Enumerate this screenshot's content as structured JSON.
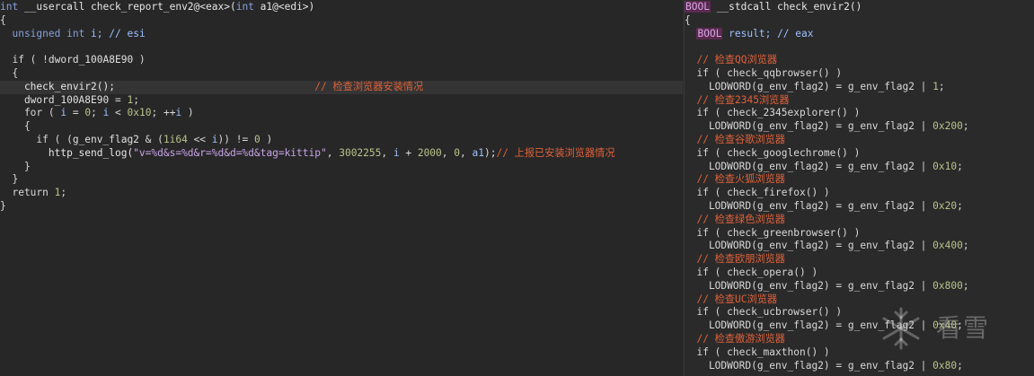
{
  "left": {
    "lines": [
      {
        "highlight": false,
        "tokens": [
          {
            "t": "int",
            "c": "kw"
          },
          {
            "t": " __usercall check_report_env2@<eax>(",
            "c": "fn"
          },
          {
            "t": "int",
            "c": "kw"
          },
          {
            "t": " a1@<edi>)",
            "c": "fn"
          }
        ]
      },
      {
        "highlight": false,
        "tokens": [
          {
            "t": "{",
            "c": "plain"
          }
        ]
      },
      {
        "highlight": false,
        "tokens": [
          {
            "t": "  unsigned ",
            "c": "kw"
          },
          {
            "t": "int",
            "c": "kw"
          },
          {
            "t": " i; ",
            "c": "var"
          },
          {
            "t": "// esi",
            "c": "var"
          }
        ]
      },
      {
        "highlight": false,
        "tokens": [
          {
            "t": "",
            "c": "plain"
          }
        ]
      },
      {
        "highlight": false,
        "tokens": [
          {
            "t": "  if ( !",
            "c": "plain"
          },
          {
            "t": "dword_100A8E90",
            "c": "gv"
          },
          {
            "t": " )",
            "c": "plain"
          }
        ]
      },
      {
        "highlight": false,
        "tokens": [
          {
            "t": "  {",
            "c": "plain"
          }
        ]
      },
      {
        "highlight": true,
        "tokens": [
          {
            "t": "    check_envir2();",
            "c": "fn"
          },
          {
            "t": "                                 ",
            "c": "plain"
          },
          {
            "t": "// 检查浏览器安装情况",
            "c": "cmt"
          }
        ]
      },
      {
        "highlight": false,
        "tokens": [
          {
            "t": "    dword_100A8E90",
            "c": "gv"
          },
          {
            "t": " = ",
            "c": "plain"
          },
          {
            "t": "1",
            "c": "num"
          },
          {
            "t": ";",
            "c": "plain"
          }
        ]
      },
      {
        "highlight": false,
        "tokens": [
          {
            "t": "    for ( ",
            "c": "plain"
          },
          {
            "t": "i",
            "c": "var"
          },
          {
            "t": " = ",
            "c": "plain"
          },
          {
            "t": "0",
            "c": "num"
          },
          {
            "t": "; ",
            "c": "plain"
          },
          {
            "t": "i",
            "c": "var"
          },
          {
            "t": " < ",
            "c": "plain"
          },
          {
            "t": "0x10",
            "c": "num"
          },
          {
            "t": "; ++",
            "c": "plain"
          },
          {
            "t": "i",
            "c": "var"
          },
          {
            "t": " )",
            "c": "plain"
          }
        ]
      },
      {
        "highlight": false,
        "tokens": [
          {
            "t": "    {",
            "c": "plain"
          }
        ]
      },
      {
        "highlight": false,
        "tokens": [
          {
            "t": "      if ( (",
            "c": "plain"
          },
          {
            "t": "g_env_flag2",
            "c": "gv"
          },
          {
            "t": " & (",
            "c": "plain"
          },
          {
            "t": "1i64",
            "c": "num"
          },
          {
            "t": " << ",
            "c": "plain"
          },
          {
            "t": "i",
            "c": "var"
          },
          {
            "t": ")) != ",
            "c": "plain"
          },
          {
            "t": "0",
            "c": "num"
          },
          {
            "t": " )",
            "c": "plain"
          }
        ]
      },
      {
        "highlight": false,
        "tokens": [
          {
            "t": "        http_send_log(",
            "c": "fn"
          },
          {
            "t": "\"v=%d&s=%d&r=%d&d=%d&tag=kittip\"",
            "c": "str"
          },
          {
            "t": ", ",
            "c": "plain"
          },
          {
            "t": "3002255",
            "c": "num"
          },
          {
            "t": ", ",
            "c": "plain"
          },
          {
            "t": "i",
            "c": "var"
          },
          {
            "t": " + ",
            "c": "plain"
          },
          {
            "t": "2000",
            "c": "num"
          },
          {
            "t": ", ",
            "c": "plain"
          },
          {
            "t": "0",
            "c": "num"
          },
          {
            "t": ", ",
            "c": "plain"
          },
          {
            "t": "a1",
            "c": "var"
          },
          {
            "t": ");",
            "c": "plain"
          },
          {
            "t": "// 上报已安装浏览器情况",
            "c": "cmt"
          }
        ]
      },
      {
        "highlight": false,
        "tokens": [
          {
            "t": "    }",
            "c": "plain"
          }
        ]
      },
      {
        "highlight": false,
        "tokens": [
          {
            "t": "  }",
            "c": "plain"
          }
        ]
      },
      {
        "highlight": false,
        "tokens": [
          {
            "t": "  return ",
            "c": "plain"
          },
          {
            "t": "1",
            "c": "num"
          },
          {
            "t": ";",
            "c": "plain"
          }
        ]
      },
      {
        "highlight": false,
        "tokens": [
          {
            "t": "}",
            "c": "plain"
          }
        ]
      }
    ]
  },
  "right": {
    "lines": [
      {
        "tokens": [
          {
            "t": "BOOL",
            "c": "boolt"
          },
          {
            "t": " __stdcall check_envir2()",
            "c": "fn"
          }
        ]
      },
      {
        "tokens": [
          {
            "t": "{",
            "c": "plain"
          }
        ]
      },
      {
        "tokens": [
          {
            "t": "  ",
            "c": "plain"
          },
          {
            "t": "BOOL",
            "c": "boolt"
          },
          {
            "t": " result; ",
            "c": "var"
          },
          {
            "t": "// eax",
            "c": "var"
          }
        ]
      },
      {
        "tokens": [
          {
            "t": "",
            "c": "plain"
          }
        ]
      },
      {
        "tokens": [
          {
            "t": "  // 检查QQ浏览器",
            "c": "cmt"
          }
        ]
      },
      {
        "tokens": [
          {
            "t": "  if ( check_qqbrowser() )",
            "c": "plain"
          }
        ]
      },
      {
        "tokens": [
          {
            "t": "    LODWORD(g_env_flag2) = g_env_flag2 | ",
            "c": "plain"
          },
          {
            "t": "1",
            "c": "num"
          },
          {
            "t": ";",
            "c": "plain"
          }
        ]
      },
      {
        "tokens": [
          {
            "t": "  // 检查2345浏览器",
            "c": "cmt"
          }
        ]
      },
      {
        "tokens": [
          {
            "t": "  if ( check_2345explorer() )",
            "c": "plain"
          }
        ]
      },
      {
        "tokens": [
          {
            "t": "    LODWORD(g_env_flag2) = g_env_flag2 | ",
            "c": "plain"
          },
          {
            "t": "0x200",
            "c": "num"
          },
          {
            "t": ";",
            "c": "plain"
          }
        ]
      },
      {
        "tokens": [
          {
            "t": "  // 检查谷歌浏览器",
            "c": "cmt"
          }
        ]
      },
      {
        "tokens": [
          {
            "t": "  if ( check_googlechrome() )",
            "c": "plain"
          }
        ]
      },
      {
        "tokens": [
          {
            "t": "    LODWORD(g_env_flag2) = g_env_flag2 | ",
            "c": "plain"
          },
          {
            "t": "0x10",
            "c": "num"
          },
          {
            "t": ";",
            "c": "plain"
          }
        ]
      },
      {
        "tokens": [
          {
            "t": "  // 检查火狐浏览器",
            "c": "cmt"
          }
        ]
      },
      {
        "tokens": [
          {
            "t": "  if ( check_firefox() )",
            "c": "plain"
          }
        ]
      },
      {
        "tokens": [
          {
            "t": "    LODWORD(g_env_flag2) = g_env_flag2 | ",
            "c": "plain"
          },
          {
            "t": "0x20",
            "c": "num"
          },
          {
            "t": ";",
            "c": "plain"
          }
        ]
      },
      {
        "tokens": [
          {
            "t": "  // 检查绿色浏览器",
            "c": "cmt"
          }
        ]
      },
      {
        "tokens": [
          {
            "t": "  if ( check_greenbrowser() )",
            "c": "plain"
          }
        ]
      },
      {
        "tokens": [
          {
            "t": "    LODWORD(g_env_flag2) = g_env_flag2 | ",
            "c": "plain"
          },
          {
            "t": "0x400",
            "c": "num"
          },
          {
            "t": ";",
            "c": "plain"
          }
        ]
      },
      {
        "tokens": [
          {
            "t": "  // 检查欧朋浏览器",
            "c": "cmt"
          }
        ]
      },
      {
        "tokens": [
          {
            "t": "  if ( check_opera() )",
            "c": "plain"
          }
        ]
      },
      {
        "tokens": [
          {
            "t": "    LODWORD(g_env_flag2) = g_env_flag2 | ",
            "c": "plain"
          },
          {
            "t": "0x800",
            "c": "num"
          },
          {
            "t": ";",
            "c": "plain"
          }
        ]
      },
      {
        "tokens": [
          {
            "t": "  // 检查UC浏览器",
            "c": "cmt"
          }
        ]
      },
      {
        "tokens": [
          {
            "t": "  if ( check_ucbrowser() )",
            "c": "plain"
          }
        ]
      },
      {
        "tokens": [
          {
            "t": "    LODWORD(g_env_flag2) = g_env_flag2 | ",
            "c": "plain"
          },
          {
            "t": "0x40",
            "c": "num"
          },
          {
            "t": ";",
            "c": "plain"
          }
        ]
      },
      {
        "tokens": [
          {
            "t": "  // 检查傲游浏览器",
            "c": "cmt"
          }
        ]
      },
      {
        "tokens": [
          {
            "t": "  if ( check_maxthon() )",
            "c": "plain"
          }
        ]
      },
      {
        "tokens": [
          {
            "t": "    LODWORD(g_env_flag2) = g_env_flag2 | ",
            "c": "plain"
          },
          {
            "t": "0x80",
            "c": "num"
          },
          {
            "t": ";",
            "c": "plain"
          }
        ]
      }
    ]
  },
  "watermark": {
    "text": "看雪",
    "icon": "snowflake-logo"
  }
}
